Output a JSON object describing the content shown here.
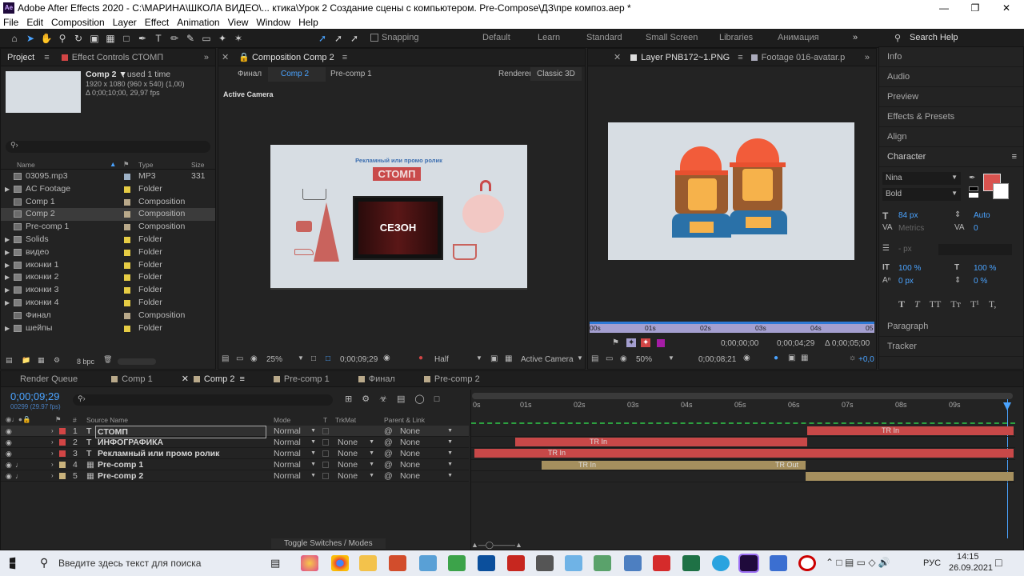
{
  "app": {
    "title": "Adobe After Effects 2020 - C:\\МАРИНА\\ШКОЛА ВИДЕО\\... ктика\\Урок 2 Создание сцены с компьютером. Pre-Compose\\ДЗ\\пре композ.aep *"
  },
  "menu": [
    "File",
    "Edit",
    "Composition",
    "Layer",
    "Effect",
    "Animation",
    "View",
    "Window",
    "Help"
  ],
  "toolbar": {
    "snapping": "Snapping",
    "workspaces": [
      "Default",
      "Learn",
      "Standard",
      "Small Screen",
      "Libraries",
      "Анимация"
    ],
    "search_help": "Search Help"
  },
  "project": {
    "tab": "Project",
    "effect_tab": "Effect Controls СТОМП",
    "selected": {
      "name": "Comp 2 ▼",
      "used": ", used 1 time",
      "dims": "1920 x 1080  (960 x 540) (1,00)",
      "duration": "Δ 0;00;10;00, 29,97 fps"
    },
    "columns": {
      "name": "Name",
      "type": "Type",
      "size": "Size"
    },
    "items": [
      {
        "name": "03095.mp3",
        "type": "MP3",
        "size": "331",
        "color": "#9fb3c8"
      },
      {
        "name": "AC Footage",
        "type": "Folder",
        "size": "",
        "color": "#e6cc44"
      },
      {
        "name": "Comp 1",
        "type": "Composition",
        "size": "",
        "color": "#b9a98a"
      },
      {
        "name": "Comp 2",
        "type": "Composition",
        "size": "",
        "color": "#b9a98a"
      },
      {
        "name": "Pre-comp 1",
        "type": "Composition",
        "size": "",
        "color": "#b9a98a"
      },
      {
        "name": "Solids",
        "type": "Folder",
        "size": "",
        "color": "#e6cc44"
      },
      {
        "name": "видео",
        "type": "Folder",
        "size": "",
        "color": "#e6cc44"
      },
      {
        "name": "иконки 1",
        "type": "Folder",
        "size": "",
        "color": "#e6cc44"
      },
      {
        "name": "иконки 2",
        "type": "Folder",
        "size": "",
        "color": "#e6cc44"
      },
      {
        "name": "иконки 3",
        "type": "Folder",
        "size": "",
        "color": "#e6cc44"
      },
      {
        "name": "иконки 4",
        "type": "Folder",
        "size": "",
        "color": "#e6cc44"
      },
      {
        "name": "Финал",
        "type": "Composition",
        "size": "",
        "color": "#b9a98a"
      },
      {
        "name": "шейпы",
        "type": "Folder",
        "size": "",
        "color": "#e6cc44"
      }
    ],
    "bpc": "8 bpc"
  },
  "comp": {
    "tab": "Composition Comp 2",
    "breadcrumbs": [
      "Финал",
      "Comp 2",
      "Pre-comp 1"
    ],
    "renderer_label": "Renderer:",
    "renderer": "Classic 3D",
    "camera_label": "Active Camera",
    "canvas": {
      "headline": "Рекламный или промо ролик",
      "brand": "СТОМП",
      "screen_text": "СЕЗОН"
    },
    "footer": {
      "zoom": "25%",
      "timecode": "0;00;09;29",
      "resolution": "Half",
      "camera": "Active Camera"
    }
  },
  "layer": {
    "tab": "Layer  PNB172~1.PNG",
    "footage_tab": "Footage 016-avatar.p",
    "ruler": [
      "00s",
      "01s",
      "02s",
      "03s",
      "04s",
      "05"
    ],
    "in": "0;00;00;00",
    "out": "0;00;04;29",
    "duration": "Δ 0;00;05;00",
    "zoom": "50%",
    "time": "0;00;08;21",
    "offset": "+0,0"
  },
  "right": {
    "items": [
      "Info",
      "Audio",
      "Preview",
      "Effects & Presets",
      "Align",
      "Character"
    ],
    "bottom_items": [
      "Paragraph",
      "Tracker"
    ],
    "character": {
      "font": "Nina",
      "style": "Bold",
      "size": "84 px",
      "leading": "Auto",
      "kerning": "Metrics",
      "tracking": "0",
      "stroke": "- px",
      "vscale": "100 %",
      "hscale": "100 %",
      "baseline": "0 px",
      "tsume": "0 %",
      "fill_color": "#d9534f",
      "styles": [
        "T",
        "T",
        "TT",
        "Tт",
        "T¹",
        "T,"
      ]
    }
  },
  "timeline": {
    "tabs": [
      "Render Queue",
      "Comp 1",
      "Comp 2",
      "Pre-comp 1",
      "Финал",
      "Pre-comp 2"
    ],
    "timecode": "0;00;09;29",
    "fps": "00299 (29.97 fps)",
    "columns": {
      "source": "Source Name",
      "mode": "Mode",
      "t": "T",
      "trkmat": "TrkMat",
      "parent": "Parent & Link"
    },
    "ruler": [
      "0s",
      "01s",
      "02s",
      "03s",
      "04s",
      "05s",
      "06s",
      "07s",
      "08s",
      "09s"
    ],
    "layers": [
      {
        "num": "1",
        "type": "T",
        "name": "СТОМП",
        "mode": "Normal",
        "trkmat": "",
        "parent": "None",
        "color": "#d24545"
      },
      {
        "num": "2",
        "type": "T",
        "name": "ИНФОГРАФИКА",
        "mode": "Normal",
        "trkmat": "None",
        "parent": "None",
        "color": "#d24545"
      },
      {
        "num": "3",
        "type": "T",
        "name": "Рекламный или промо ролик",
        "mode": "Normal",
        "trkmat": "None",
        "parent": "None",
        "color": "#d24545"
      },
      {
        "num": "4",
        "type": "▦",
        "name": "Pre-comp 1",
        "mode": "Normal",
        "trkmat": "None",
        "parent": "None",
        "color": "#c9b27c"
      },
      {
        "num": "5",
        "type": "▦",
        "name": "Pre-comp 2",
        "mode": "Normal",
        "trkmat": "None",
        "parent": "None",
        "color": "#c9b27c"
      }
    ],
    "markers": {
      "tr_in": "TR In",
      "tr_out": "TR Out"
    },
    "toggle": "Toggle Switches / Modes"
  },
  "taskbar": {
    "search": "Введите здесь текст для поиска",
    "lang": "РУС",
    "time": "14:15",
    "date": "26.09.2021"
  }
}
